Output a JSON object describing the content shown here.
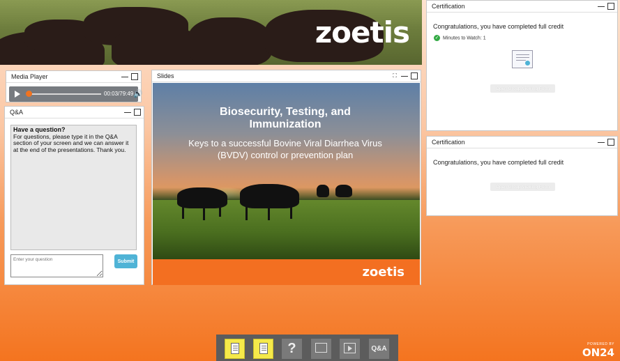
{
  "banner": {
    "brand_logo": "zoetis"
  },
  "media_player": {
    "title": "Media Player",
    "time_display": "00:03/79:49",
    "progress_fraction": 0.001
  },
  "qa": {
    "title": "Q&A",
    "heading": "Have a question?",
    "body": "For questions, please type it in the Q&A section of your screen and we can answer it at the end of the presentations. Thank you.",
    "input_placeholder": "Enter your question",
    "submit_label": "Submit"
  },
  "slides": {
    "title": "Slides",
    "slide_title": "Biosecurity, Testing, and Immunization",
    "slide_subtitle": "Keys to a successful Bovine Viral Diarrhea Virus (BVDV) control or prevention plan",
    "footer_logo": "zoetis"
  },
  "certification_1": {
    "title": "Certification",
    "message": "Congratulations, you have completed full credit",
    "minutes_label": "Minutes to Watch: 1",
    "form_button": "Open Group Viewing Form"
  },
  "certification_2": {
    "title": "Certification",
    "message": "Congratulations, you have completed full credit",
    "form_button": "Open Group Viewing Form"
  },
  "toolbar": {
    "items": [
      {
        "icon": "resources-doc-icon",
        "label": ""
      },
      {
        "icon": "notes-doc-icon",
        "label": ""
      },
      {
        "icon": "help-icon",
        "label": "?"
      },
      {
        "icon": "slides-icon",
        "label": ""
      },
      {
        "icon": "media-player-icon",
        "label": ""
      },
      {
        "icon": "qa-icon",
        "label": "Q&A"
      }
    ]
  },
  "powered_by": {
    "prefix": "POWERED BY",
    "brand": "ON24"
  },
  "colors": {
    "accent_orange": "#f36f21",
    "submit_blue": "#4fb3d6",
    "toolbar_yellow": "#f5e94a",
    "check_green": "#33aa44"
  }
}
